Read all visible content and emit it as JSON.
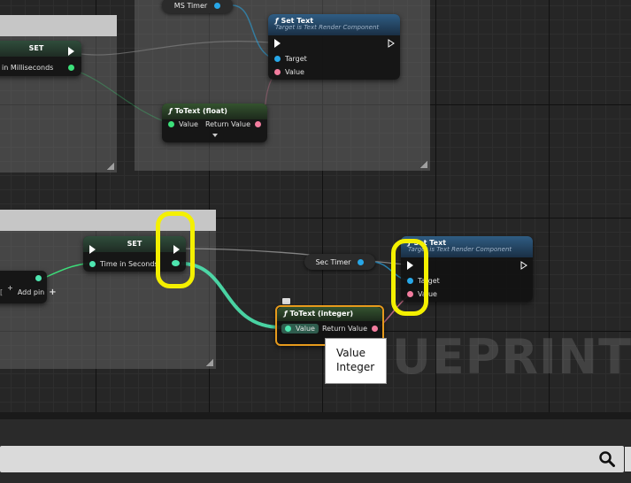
{
  "nodes": {
    "set_ms": {
      "title": "SET",
      "pin_label": "in Milliseconds"
    },
    "ms_timer": {
      "label": "MS Timer"
    },
    "set_text_top": {
      "title": "Set Text",
      "subtitle": "Target is Text Render Component",
      "target": "Target",
      "value": "Value"
    },
    "totext_float": {
      "title": "ToText (float)",
      "value": "Value",
      "return": "Return Value"
    },
    "set_sec": {
      "title": "SET",
      "pin_label": "Time in Seconds"
    },
    "add_pin": {
      "label": "Add pin"
    },
    "sec_timer": {
      "label": "Sec Timer"
    },
    "set_text_bottom": {
      "title": "Set Text",
      "subtitle": "Target is Text Render Component",
      "target": "Target",
      "value": "Value"
    },
    "totext_int": {
      "title": "ToText (integer)",
      "value": "Value",
      "return": "Return Value"
    }
  },
  "tooltip": {
    "line1": "Value",
    "line2": "Integer"
  },
  "watermark": "UEPRINT",
  "colors": {
    "highlight": "#f4f000",
    "exec_wire": "#ffffff",
    "int_wire": "#4ee6b0",
    "text_pin": "#f27c9e",
    "object_pin": "#27a7e8"
  },
  "icons": {
    "search": "search-icon",
    "function": "function-icon"
  }
}
